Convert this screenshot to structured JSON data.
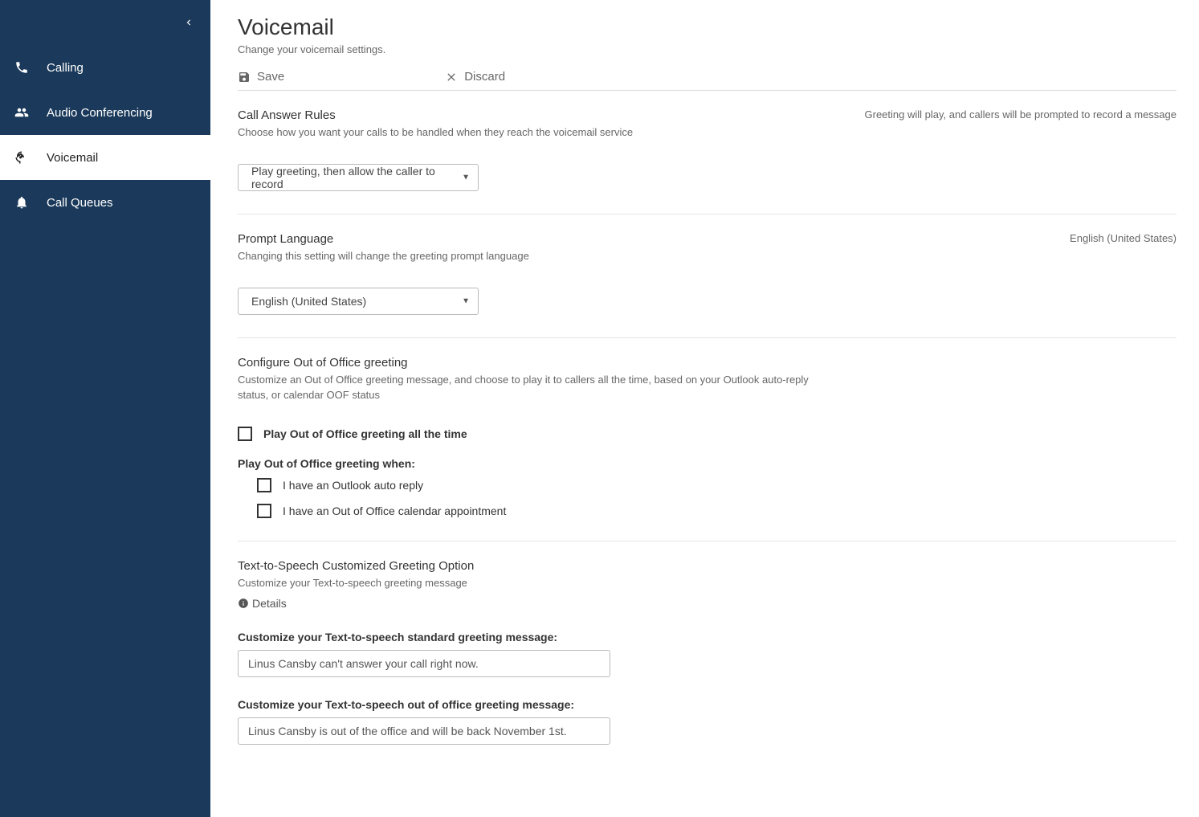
{
  "sidebar": {
    "items": [
      {
        "label": "Calling"
      },
      {
        "label": "Audio Conferencing"
      },
      {
        "label": "Voicemail"
      },
      {
        "label": "Call Queues"
      }
    ]
  },
  "page": {
    "title": "Voicemail",
    "subtitle": "Change your voicemail settings."
  },
  "toolbar": {
    "save": "Save",
    "discard": "Discard"
  },
  "callAnswer": {
    "title": "Call Answer Rules",
    "desc": "Choose how you want your calls to be handled when they reach the voicemail service",
    "summary": "Greeting will play, and callers will be prompted to record a message",
    "selected": "Play greeting, then allow the caller to record"
  },
  "promptLang": {
    "title": "Prompt Language",
    "desc": "Changing this setting will change the greeting prompt language",
    "summary": "English (United States)",
    "selected": "English (United States)"
  },
  "oof": {
    "title": "Configure Out of Office greeting",
    "desc": "Customize an Out of Office greeting message, and choose to play it to callers all the time, based on your Outlook auto-reply status, or calendar OOF status",
    "playAll": "Play Out of Office greeting all the time",
    "whenHead": "Play Out of Office greeting when:",
    "outlook": "I have an Outlook auto reply",
    "calendar": "I have an Out of Office calendar appointment"
  },
  "tts": {
    "title": "Text-to-Speech Customized Greeting Option",
    "desc": "Customize your Text-to-speech greeting message",
    "details": "Details",
    "stdLabel": "Customize your Text-to-speech standard greeting message:",
    "stdValue": "Linus Cansby can't answer your call right now.",
    "oofLabel": "Customize your Text-to-speech out of office greeting message:",
    "oofValue": "Linus Cansby is out of the office and will be back November 1st."
  }
}
